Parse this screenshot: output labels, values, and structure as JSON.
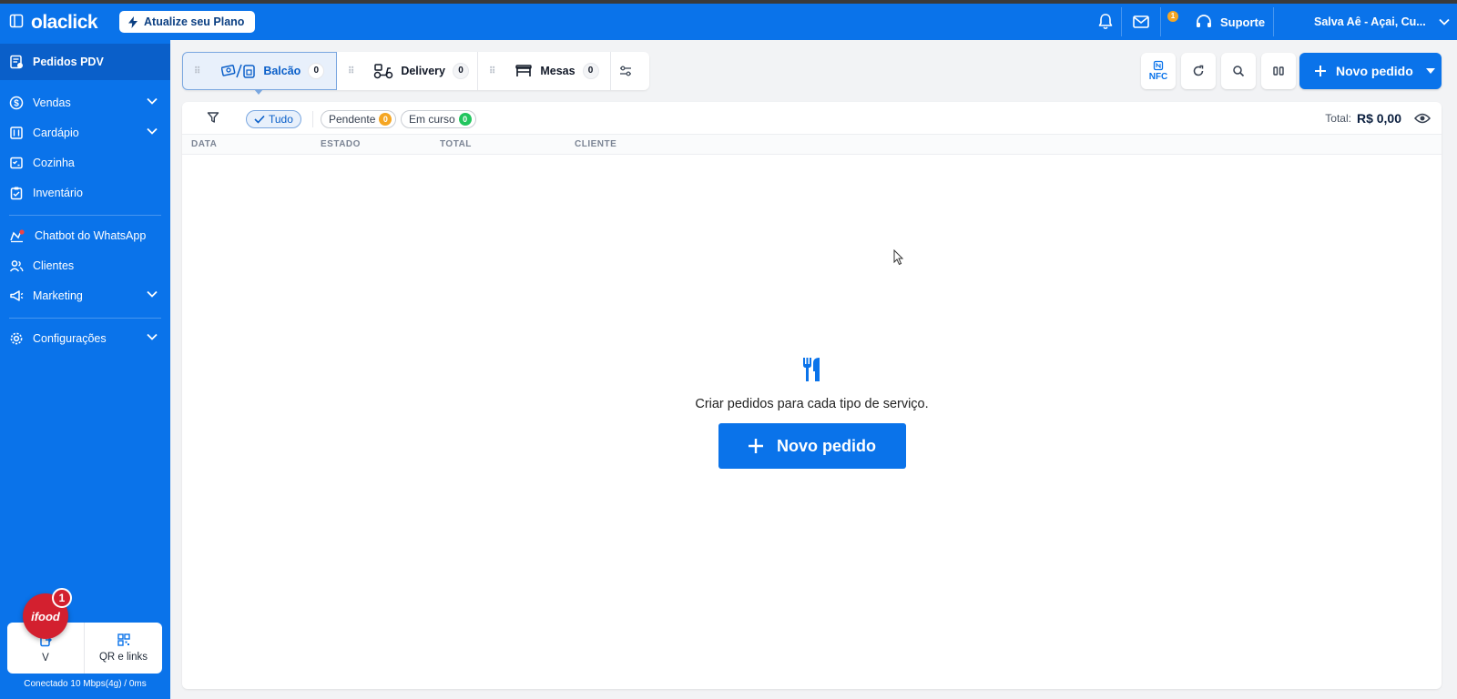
{
  "topbar": {
    "logo": "olaclick",
    "upgrade_label": "Atualize seu Plano",
    "mail_badge": "1",
    "support_label": "Suporte",
    "store_name": "Salva Aê - Açai, Cu..."
  },
  "sidebar": {
    "active_label": "Pedidos PDV",
    "items": [
      {
        "label": "Vendas",
        "icon": "dollar-icon",
        "expandable": true
      },
      {
        "label": "Cardápio",
        "icon": "menu-book-icon",
        "expandable": true
      },
      {
        "label": "Cozinha",
        "icon": "kitchen-icon",
        "expandable": false
      },
      {
        "label": "Inventário",
        "icon": "clipboard-icon",
        "expandable": false
      },
      {
        "label": "Chatbot do WhatsApp",
        "icon": "chatbot-icon",
        "expandable": false
      },
      {
        "label": "Clientes",
        "icon": "users-icon",
        "expandable": false
      },
      {
        "label": "Marketing",
        "icon": "megaphone-icon",
        "expandable": true
      },
      {
        "label": "Configurações",
        "icon": "gear-icon",
        "expandable": true
      }
    ],
    "bottom": {
      "left_label": "V",
      "right_label": "QR e links"
    },
    "connection": "Conectado 10 Mbps(4g) / 0ms",
    "ifood_label": "ifood",
    "ifood_badge": "1"
  },
  "tabs": [
    {
      "label": "Balcão",
      "count": "0",
      "active": true
    },
    {
      "label": "Delivery",
      "count": "0",
      "active": false
    },
    {
      "label": "Mesas",
      "count": "0",
      "active": false
    }
  ],
  "toolbar": {
    "nfc_label": "NFC",
    "new_order_label": "Novo pedido"
  },
  "filters": {
    "chips": [
      {
        "label": "Tudo",
        "selected": true
      },
      {
        "label": "Pendente",
        "count": "0",
        "color": "#f5a623"
      },
      {
        "label": "Em curso",
        "count": "0",
        "color": "#22c55e"
      }
    ],
    "total_label": "Total:",
    "total_value": "R$ 0,00"
  },
  "table": {
    "columns": [
      "DATA",
      "ESTADO",
      "TOTAL",
      "CLIENTE"
    ]
  },
  "empty_state": {
    "message": "Criar pedidos para cada tipo de serviço.",
    "button_label": "Novo pedido"
  },
  "colors": {
    "brand": "#0a73ea",
    "brand_dark": "#0a5fc9"
  }
}
